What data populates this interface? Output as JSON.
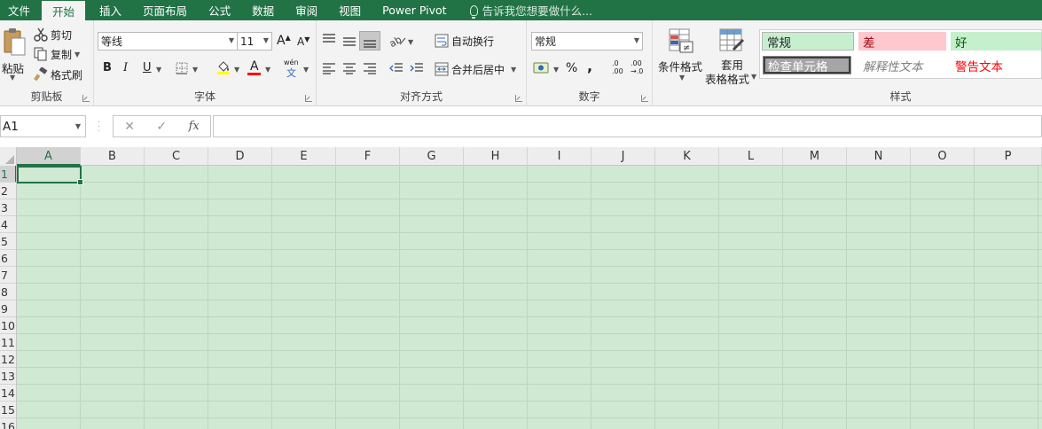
{
  "tabs": [
    "文件",
    "开始",
    "插入",
    "页面布局",
    "公式",
    "数据",
    "审阅",
    "视图",
    "Power Pivot"
  ],
  "active_tab": "开始",
  "tell_me": "告诉我您想要做什么...",
  "clipboard": {
    "label": "剪贴板",
    "paste": "粘贴",
    "cut": "剪切",
    "copy": "复制",
    "format_painter": "格式刷"
  },
  "font": {
    "label": "字体",
    "name": "等线",
    "size": "11",
    "bold": "B",
    "italic": "I",
    "underline": "U",
    "grow": "A",
    "shrink": "A",
    "font_color_letter": "A",
    "phonetic": "wén",
    "phonetic_sub": "文",
    "highlight_color": "#ffff00",
    "font_color": "#ff0000"
  },
  "alignment": {
    "label": "对齐方式",
    "wrap_text": "自动换行",
    "merge_center": "合并后居中"
  },
  "number": {
    "label": "数字",
    "format": "常规",
    "percent": "%",
    "comma": ",",
    "inc_decimal_top": ".0",
    "inc_decimal_bottom": ".00",
    "dec_decimal_top": ".00",
    "dec_decimal_bottom": "→.0"
  },
  "styles": {
    "label": "样式",
    "conditional_formatting": "条件格式",
    "format_as_table_line1": "套用",
    "format_as_table_line2": "表格格式",
    "cells": [
      {
        "name": "常规",
        "bg": "#c6efce",
        "fg": "#222222"
      },
      {
        "name": "差",
        "bg": "#ffc7ce",
        "fg": "#9c0006"
      },
      {
        "name": "好",
        "bg": "#c6efce",
        "fg": "#006100"
      },
      {
        "name": "检查单元格",
        "bg": "#a5a5a5",
        "fg": "#ffffff"
      },
      {
        "name": "解释性文本",
        "bg": "#ffffff",
        "fg": "#7f7f7f"
      },
      {
        "name": "警告文本",
        "bg": "#ffffff",
        "fg": "#ff0000"
      }
    ]
  },
  "formula_bar": {
    "name_box": "A1",
    "cancel": "✕",
    "enter": "✓",
    "fx": "fx",
    "content": ""
  },
  "grid": {
    "columns": [
      "A",
      "B",
      "C",
      "D",
      "E",
      "F",
      "G",
      "H",
      "I",
      "J",
      "K",
      "L",
      "M",
      "N",
      "O",
      "P"
    ],
    "rows": [
      "1",
      "2",
      "3",
      "4",
      "5",
      "6",
      "7",
      "8",
      "9",
      "10",
      "11",
      "12",
      "13",
      "14",
      "15",
      "16"
    ],
    "selected_cell": "A1",
    "sheet_bg": "#cfe9d3"
  },
  "colors": {
    "brand": "#217346",
    "ribbon_bg": "#f3f3f3"
  }
}
